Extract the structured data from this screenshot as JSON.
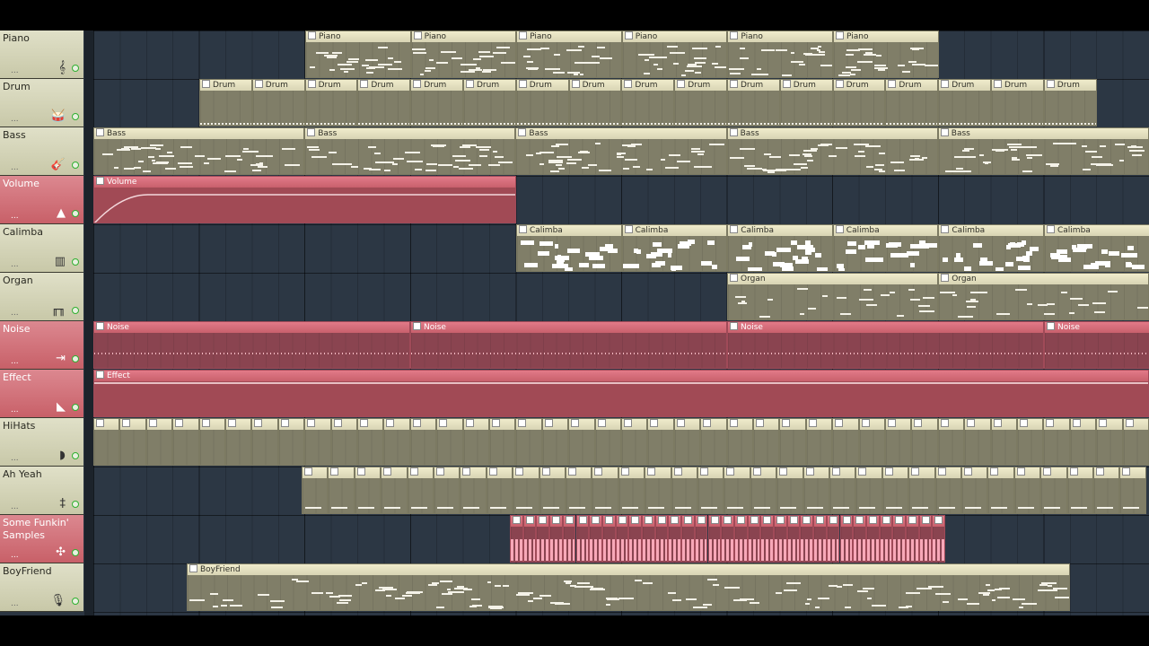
{
  "tracks": [
    {
      "name": "Piano",
      "dots": "...",
      "icon": "treble-clef-icon",
      "glyph": "𝄞",
      "auto": false
    },
    {
      "name": "Drum",
      "dots": "...",
      "icon": "drum-icon",
      "glyph": "🥁",
      "auto": false
    },
    {
      "name": "Bass",
      "dots": "...",
      "icon": "guitar-icon",
      "glyph": "🎸",
      "auto": false
    },
    {
      "name": "Volume",
      "dots": "...",
      "icon": "ramp-icon",
      "glyph": "▲",
      "auto": true
    },
    {
      "name": "Calimba",
      "dots": "...",
      "icon": "kalimba-icon",
      "glyph": "▥",
      "auto": false
    },
    {
      "name": "Organ",
      "dots": "...",
      "icon": "organ-icon",
      "glyph": "╓╖",
      "auto": false
    },
    {
      "name": "Noise",
      "dots": "...",
      "icon": "audio-icon",
      "glyph": "⇥",
      "auto": true
    },
    {
      "name": "Effect",
      "dots": "...",
      "icon": "envelope-icon",
      "glyph": "◣",
      "auto": true
    },
    {
      "name": "HiHats",
      "dots": "...",
      "icon": "hihat-icon",
      "glyph": "◗",
      "auto": false
    },
    {
      "name": "Ah Yeah",
      "dots": "...",
      "icon": "choir-icon",
      "glyph": "‡",
      "auto": false
    },
    {
      "name": "Some Funkin'\nSamples",
      "dots": "...",
      "icon": "sample-icon",
      "glyph": "✣",
      "auto": true
    },
    {
      "name": "BoyFriend",
      "dots": "...",
      "icon": "microphone-icon",
      "glyph": "🎙",
      "auto": false
    }
  ],
  "clip_labels": {
    "piano": "Piano",
    "drum": "Drum",
    "bass": "Bass",
    "volume": "Volume",
    "calimba": "Calimba",
    "organ": "Organ",
    "noise": "Noise",
    "effect": "Effect",
    "boyfriend": "BoyFriend"
  },
  "colors": {
    "pattern_clip": "#d8d4b4",
    "automation_clip": "#c8606c",
    "led": "#30b030",
    "playlist_bg": "#2c3744"
  }
}
